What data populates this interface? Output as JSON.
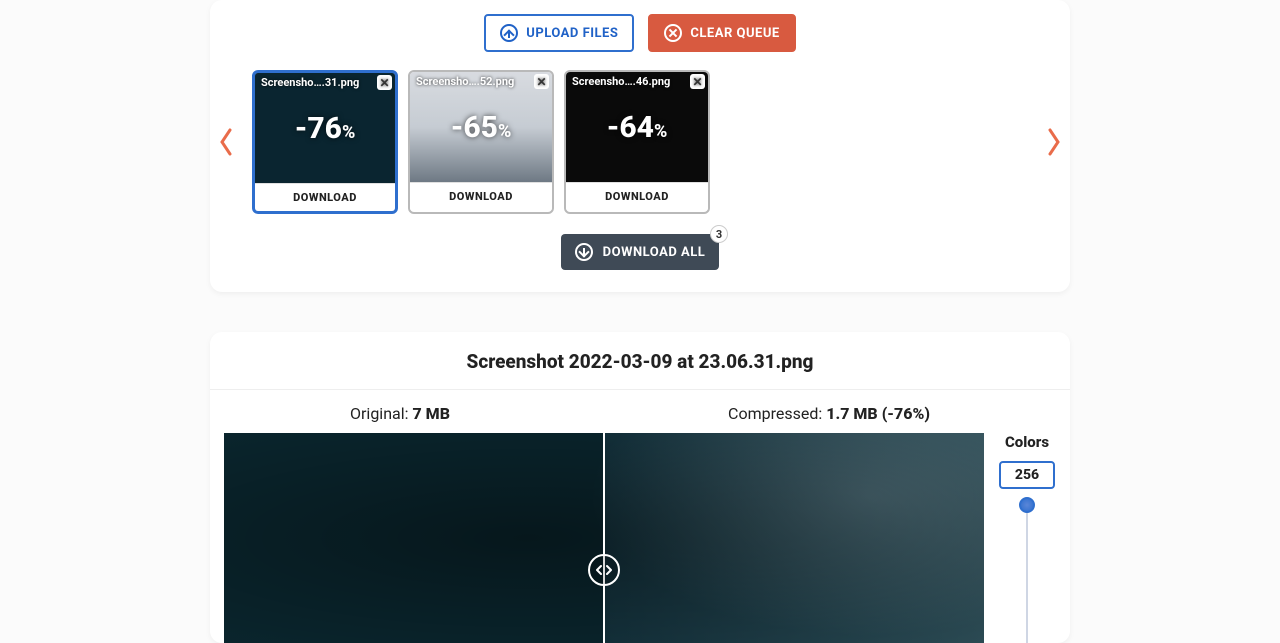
{
  "toolbar": {
    "upload_label": "UPLOAD FILES",
    "clear_label": "CLEAR QUEUE"
  },
  "queue": {
    "items": [
      {
        "filename": "Screensho….31.png",
        "savings": "-76",
        "download_label": "DOWNLOAD",
        "selected": true
      },
      {
        "filename": "Screensho….52.png",
        "savings": "-65",
        "download_label": "DOWNLOAD",
        "selected": false
      },
      {
        "filename": "Screensho….46.png",
        "savings": "-64",
        "download_label": "DOWNLOAD",
        "selected": false
      }
    ],
    "download_all_label": "DOWNLOAD ALL",
    "download_all_count": "3",
    "percent_sign": "%"
  },
  "detail": {
    "filename": "Screenshot 2022-03-09 at 23.06.31.png",
    "original_label": "Original: ",
    "original_value": "7 MB",
    "compressed_label": "Compressed: ",
    "compressed_value": "1.7 MB (-76%)",
    "colors_label": "Colors",
    "colors_value": "256"
  }
}
